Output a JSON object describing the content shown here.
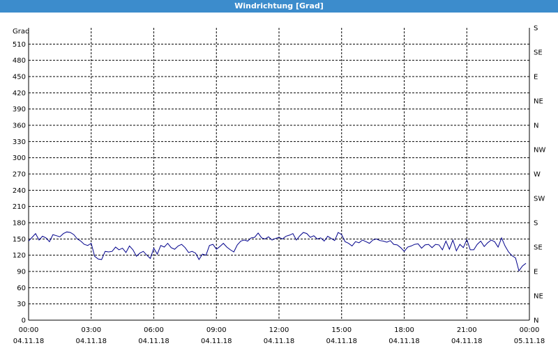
{
  "window": {
    "title": "Windrichtung [Grad]"
  },
  "chart_data": {
    "type": "line",
    "title": "Windrichtung [Grad]",
    "ylabel": "Grad",
    "ylim": [
      0,
      540
    ],
    "yticks": [
      0,
      30,
      60,
      90,
      120,
      150,
      180,
      210,
      240,
      270,
      300,
      330,
      360,
      390,
      420,
      450,
      480,
      510
    ],
    "right_axis_labels": [
      "N",
      "NE",
      "E",
      "SE",
      "S",
      "SW",
      "W",
      "NW",
      "N",
      "NE",
      "E",
      "SE",
      "S"
    ],
    "xlim": [
      "2018-11-04 00:00",
      "2018-11-05 00:00"
    ],
    "xticks": [
      {
        "time": "00:00",
        "date": "04.11.18"
      },
      {
        "time": "03:00",
        "date": "04.11.18"
      },
      {
        "time": "06:00",
        "date": "04.11.18"
      },
      {
        "time": "09:00",
        "date": "04.11.18"
      },
      {
        "time": "12:00",
        "date": "04.11.18"
      },
      {
        "time": "15:00",
        "date": "04.11.18"
      },
      {
        "time": "18:00",
        "date": "04.11.18"
      },
      {
        "time": "21:00",
        "date": "04.11.18"
      },
      {
        "time": "00:00",
        "date": "05.11.18"
      }
    ],
    "grid": true,
    "line_color": "#00008b",
    "series": [
      {
        "x": [
          "00:00",
          "00:10",
          "00:20",
          "00:30",
          "00:40",
          "00:50",
          "01:00",
          "01:10",
          "01:20",
          "01:30",
          "01:40",
          "01:50",
          "02:00",
          "02:10",
          "02:20",
          "02:30",
          "02:40",
          "02:50",
          "03:00",
          "03:10",
          "03:20",
          "03:30",
          "03:40",
          "03:50",
          "04:00",
          "04:10",
          "04:20",
          "04:30",
          "04:40",
          "04:50",
          "05:00",
          "05:10",
          "05:20",
          "05:30",
          "05:40",
          "05:50",
          "06:00",
          "06:10",
          "06:20",
          "06:30",
          "06:40",
          "06:50",
          "07:00",
          "07:10",
          "07:20",
          "07:30",
          "07:40",
          "07:50",
          "08:00",
          "08:10",
          "08:20",
          "08:30",
          "08:40",
          "08:50",
          "09:00",
          "09:10",
          "09:20",
          "09:30",
          "09:40",
          "09:50",
          "10:00",
          "10:10",
          "10:20",
          "10:30",
          "10:40",
          "10:50",
          "11:00",
          "11:10",
          "11:20",
          "11:30",
          "11:40",
          "11:50",
          "12:00",
          "12:10",
          "12:20",
          "12:30",
          "12:40",
          "12:50",
          "13:00",
          "13:10",
          "13:20",
          "13:30",
          "13:40",
          "13:50",
          "14:00",
          "14:10",
          "14:20",
          "14:30",
          "14:40",
          "14:50",
          "15:00",
          "15:10",
          "15:20",
          "15:30",
          "15:40",
          "15:50",
          "16:00",
          "16:10",
          "16:20",
          "16:30",
          "16:40",
          "16:50",
          "17:00",
          "17:10",
          "17:20",
          "17:30",
          "17:40",
          "17:50",
          "18:00",
          "18:10",
          "18:20",
          "18:30",
          "18:40",
          "18:50",
          "19:00",
          "19:10",
          "19:20",
          "19:30",
          "19:40",
          "19:50",
          "20:00",
          "20:10",
          "20:20",
          "20:30",
          "20:40",
          "20:50",
          "21:00",
          "21:10",
          "21:20",
          "21:30",
          "21:40",
          "21:50",
          "22:00",
          "22:10",
          "22:20",
          "22:30",
          "22:40",
          "22:50",
          "23:00",
          "23:10",
          "23:20",
          "23:30",
          "23:40",
          "23:50"
        ],
        "values": [
          146,
          153,
          160,
          148,
          155,
          152,
          145,
          158,
          156,
          154,
          160,
          163,
          162,
          158,
          150,
          146,
          140,
          138,
          142,
          118,
          113,
          112,
          127,
          126,
          127,
          135,
          130,
          133,
          125,
          137,
          130,
          118,
          124,
          127,
          120,
          114,
          133,
          122,
          138,
          135,
          142,
          134,
          131,
          137,
          140,
          134,
          125,
          127,
          124,
          112,
          122,
          120,
          138,
          140,
          131,
          136,
          142,
          135,
          130,
          126,
          139,
          146,
          148,
          146,
          152,
          153,
          161,
          152,
          150,
          154,
          148,
          151,
          153,
          150,
          155,
          157,
          160,
          148,
          156,
          162,
          160,
          153,
          156,
          150,
          152,
          146,
          155,
          151,
          147,
          162,
          158,
          145,
          142,
          137,
          145,
          143,
          148,
          145,
          142,
          148,
          150,
          147,
          146,
          144,
          147,
          140,
          139,
          134,
          127,
          135,
          137,
          140,
          141,
          133,
          139,
          140,
          134,
          140,
          139,
          130,
          146,
          131,
          148,
          128,
          140,
          134,
          149,
          130,
          130,
          140,
          146,
          136,
          143,
          148,
          145,
          135,
          152,
          137,
          126,
          119,
          115,
          91,
          100,
          105
        ]
      }
    ]
  }
}
